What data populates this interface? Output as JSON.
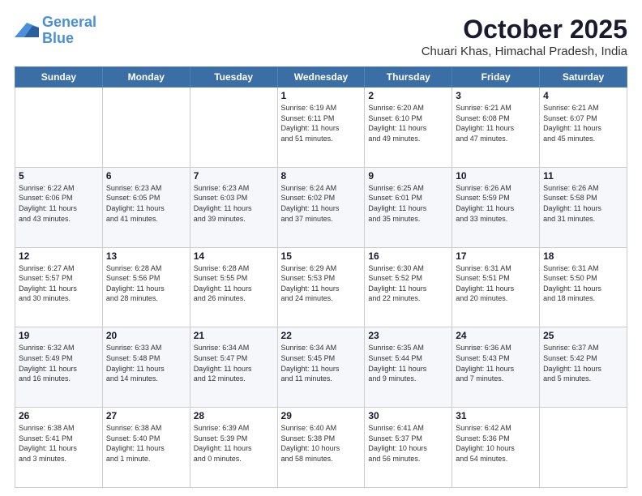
{
  "header": {
    "logo_general": "General",
    "logo_blue": "Blue",
    "month": "October 2025",
    "location": "Chuari Khas, Himachal Pradesh, India"
  },
  "weekdays": [
    "Sunday",
    "Monday",
    "Tuesday",
    "Wednesday",
    "Thursday",
    "Friday",
    "Saturday"
  ],
  "weeks": [
    [
      {
        "day": "",
        "info": ""
      },
      {
        "day": "",
        "info": ""
      },
      {
        "day": "",
        "info": ""
      },
      {
        "day": "1",
        "info": "Sunrise: 6:19 AM\nSunset: 6:11 PM\nDaylight: 11 hours\nand 51 minutes."
      },
      {
        "day": "2",
        "info": "Sunrise: 6:20 AM\nSunset: 6:10 PM\nDaylight: 11 hours\nand 49 minutes."
      },
      {
        "day": "3",
        "info": "Sunrise: 6:21 AM\nSunset: 6:08 PM\nDaylight: 11 hours\nand 47 minutes."
      },
      {
        "day": "4",
        "info": "Sunrise: 6:21 AM\nSunset: 6:07 PM\nDaylight: 11 hours\nand 45 minutes."
      }
    ],
    [
      {
        "day": "5",
        "info": "Sunrise: 6:22 AM\nSunset: 6:06 PM\nDaylight: 11 hours\nand 43 minutes."
      },
      {
        "day": "6",
        "info": "Sunrise: 6:23 AM\nSunset: 6:05 PM\nDaylight: 11 hours\nand 41 minutes."
      },
      {
        "day": "7",
        "info": "Sunrise: 6:23 AM\nSunset: 6:03 PM\nDaylight: 11 hours\nand 39 minutes."
      },
      {
        "day": "8",
        "info": "Sunrise: 6:24 AM\nSunset: 6:02 PM\nDaylight: 11 hours\nand 37 minutes."
      },
      {
        "day": "9",
        "info": "Sunrise: 6:25 AM\nSunset: 6:01 PM\nDaylight: 11 hours\nand 35 minutes."
      },
      {
        "day": "10",
        "info": "Sunrise: 6:26 AM\nSunset: 5:59 PM\nDaylight: 11 hours\nand 33 minutes."
      },
      {
        "day": "11",
        "info": "Sunrise: 6:26 AM\nSunset: 5:58 PM\nDaylight: 11 hours\nand 31 minutes."
      }
    ],
    [
      {
        "day": "12",
        "info": "Sunrise: 6:27 AM\nSunset: 5:57 PM\nDaylight: 11 hours\nand 30 minutes."
      },
      {
        "day": "13",
        "info": "Sunrise: 6:28 AM\nSunset: 5:56 PM\nDaylight: 11 hours\nand 28 minutes."
      },
      {
        "day": "14",
        "info": "Sunrise: 6:28 AM\nSunset: 5:55 PM\nDaylight: 11 hours\nand 26 minutes."
      },
      {
        "day": "15",
        "info": "Sunrise: 6:29 AM\nSunset: 5:53 PM\nDaylight: 11 hours\nand 24 minutes."
      },
      {
        "day": "16",
        "info": "Sunrise: 6:30 AM\nSunset: 5:52 PM\nDaylight: 11 hours\nand 22 minutes."
      },
      {
        "day": "17",
        "info": "Sunrise: 6:31 AM\nSunset: 5:51 PM\nDaylight: 11 hours\nand 20 minutes."
      },
      {
        "day": "18",
        "info": "Sunrise: 6:31 AM\nSunset: 5:50 PM\nDaylight: 11 hours\nand 18 minutes."
      }
    ],
    [
      {
        "day": "19",
        "info": "Sunrise: 6:32 AM\nSunset: 5:49 PM\nDaylight: 11 hours\nand 16 minutes."
      },
      {
        "day": "20",
        "info": "Sunrise: 6:33 AM\nSunset: 5:48 PM\nDaylight: 11 hours\nand 14 minutes."
      },
      {
        "day": "21",
        "info": "Sunrise: 6:34 AM\nSunset: 5:47 PM\nDaylight: 11 hours\nand 12 minutes."
      },
      {
        "day": "22",
        "info": "Sunrise: 6:34 AM\nSunset: 5:45 PM\nDaylight: 11 hours\nand 11 minutes."
      },
      {
        "day": "23",
        "info": "Sunrise: 6:35 AM\nSunset: 5:44 PM\nDaylight: 11 hours\nand 9 minutes."
      },
      {
        "day": "24",
        "info": "Sunrise: 6:36 AM\nSunset: 5:43 PM\nDaylight: 11 hours\nand 7 minutes."
      },
      {
        "day": "25",
        "info": "Sunrise: 6:37 AM\nSunset: 5:42 PM\nDaylight: 11 hours\nand 5 minutes."
      }
    ],
    [
      {
        "day": "26",
        "info": "Sunrise: 6:38 AM\nSunset: 5:41 PM\nDaylight: 11 hours\nand 3 minutes."
      },
      {
        "day": "27",
        "info": "Sunrise: 6:38 AM\nSunset: 5:40 PM\nDaylight: 11 hours\nand 1 minute."
      },
      {
        "day": "28",
        "info": "Sunrise: 6:39 AM\nSunset: 5:39 PM\nDaylight: 11 hours\nand 0 minutes."
      },
      {
        "day": "29",
        "info": "Sunrise: 6:40 AM\nSunset: 5:38 PM\nDaylight: 10 hours\nand 58 minutes."
      },
      {
        "day": "30",
        "info": "Sunrise: 6:41 AM\nSunset: 5:37 PM\nDaylight: 10 hours\nand 56 minutes."
      },
      {
        "day": "31",
        "info": "Sunrise: 6:42 AM\nSunset: 5:36 PM\nDaylight: 10 hours\nand 54 minutes."
      },
      {
        "day": "",
        "info": ""
      }
    ]
  ]
}
